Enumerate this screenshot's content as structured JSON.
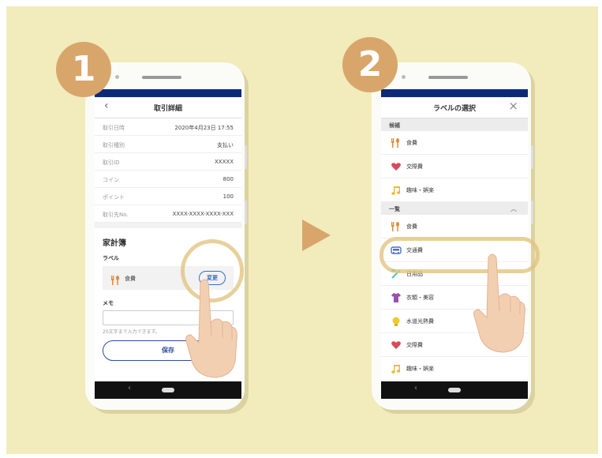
{
  "steps": {
    "one": "1",
    "two": "2"
  },
  "left": {
    "header_title": "取引詳細",
    "details": [
      {
        "key": "取引日時",
        "value": "2020年4月23日 17:55"
      },
      {
        "key": "取引種別",
        "value": "支払い"
      },
      {
        "key": "取引ID",
        "value": "XXXXX"
      },
      {
        "key": "コイン",
        "value": "800"
      },
      {
        "key": "ポイント",
        "value": "100"
      },
      {
        "key": "取引先No.",
        "value": "XXXX-XXXX-XXXX-XXX"
      }
    ],
    "kakeibo_title": "家計簿",
    "label_heading": "ラベル",
    "current_label": "食費",
    "change_button": "変更",
    "memo_heading": "メモ",
    "memo_hint": "20文字まで入力できます。",
    "save_button": "保存"
  },
  "right": {
    "header_title": "ラベルの選択",
    "candidates_heading": "候補",
    "candidates": [
      {
        "label": "食費",
        "icon": "fork-knife-icon"
      },
      {
        "label": "交際費",
        "icon": "heart-icon"
      },
      {
        "label": "趣味・娯楽",
        "icon": "music-note-icon"
      }
    ],
    "list_heading": "一覧",
    "list": [
      {
        "label": "食費",
        "icon": "fork-knife-icon"
      },
      {
        "label": "交通費",
        "icon": "car-icon"
      },
      {
        "label": "日用品",
        "icon": "toothbrush-icon"
      },
      {
        "label": "衣類・美容",
        "icon": "shirt-icon"
      },
      {
        "label": "水道光熱費",
        "icon": "lightbulb-icon"
      },
      {
        "label": "交際費",
        "icon": "heart-icon"
      },
      {
        "label": "趣味・娯楽",
        "icon": "music-note-icon"
      }
    ]
  },
  "colors": {
    "background": "#f2ebbb",
    "accent": "#d8a66b",
    "status_bar": "#0d2a78",
    "button_blue": "#2b4d9e"
  }
}
